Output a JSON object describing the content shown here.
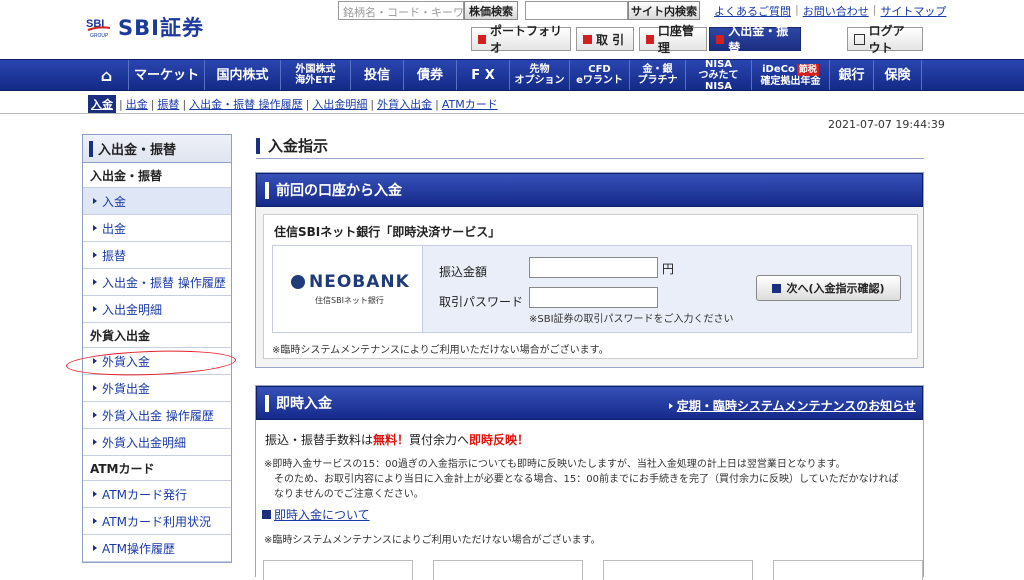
{
  "header": {
    "logo_text": "SBI証券",
    "logo_sub": "GROUP",
    "brand_search_placeholder": "銘柄名・コード・キーワード",
    "brand_search_button": "株価検索",
    "site_search_button": "サイト内検索",
    "links": [
      "よくあるご質問",
      "お問い合わせ",
      "サイトマップ"
    ],
    "top_buttons": [
      "ポートフォリオ",
      "取 引",
      "口座管理",
      "入出金・振替"
    ],
    "logout": "ログアウト"
  },
  "nav": {
    "home": "⌂",
    "items": [
      "マーケット",
      "国内株式",
      "外国株式",
      "海外ETF",
      "投信",
      "債券",
      "F X",
      "先物",
      "オプション",
      "CFD",
      "eワラント",
      "金・銀",
      "プラチナ",
      "NISA",
      "つみたてNISA",
      "iDeCo",
      "節税",
      "確定拠出年金",
      "銀行",
      "保険"
    ]
  },
  "subnav": [
    "入金",
    "出金",
    "振替",
    "入出金・振替 操作履歴",
    "入出金明細",
    "外貨入出金",
    "ATMカード"
  ],
  "datetime": "2021-07-07 19:44:39",
  "sidebar": {
    "title": "入出金・振替",
    "groups": [
      {
        "head": "入出金・振替",
        "items": [
          "入金",
          "出金",
          "振替",
          "入出金・振替 操作履歴",
          "入出金明細"
        ]
      },
      {
        "head": "外貨入出金",
        "items": [
          "外貨入金",
          "外貨出金",
          "外貨入出金 操作履歴",
          "外貨入出金明細"
        ]
      },
      {
        "head": "ATMカード",
        "items": [
          "ATMカード発行",
          "ATMカード利用状況",
          "ATM操作履歴"
        ]
      }
    ]
  },
  "main": {
    "title": "入金指示",
    "panel1": {
      "head": "前回の口座から入金",
      "bank": "住信SBIネット銀行「即時決済サービス」",
      "bank_logo": "NEOBANK",
      "bank_logo_sub": "住信SBIネット銀行",
      "amount_label": "振込金額",
      "amount_value": "",
      "yen": "円",
      "password_label": "取引パスワード",
      "password_value": "",
      "password_note": "※SBI証券の取引パスワードをご入力ください",
      "next_button": "次へ(入金指示確認)",
      "maintenance_note": "※臨時システムメンテナンスによりご利用いただけない場合がございます。"
    },
    "panel2": {
      "head": "即時入金",
      "notice_link": "定期・臨時システムメンテナンスのお知らせ",
      "fee_pre": "振込・振替手数料は",
      "fee_free": "無料！",
      "fee_mid": "買付余力へ",
      "fee_instant": "即時反映！",
      "note1": "※即時入金サービスの15：00過ぎの入金指示についても即時に反映いたしますが、当社入金処理の計上日は翌営業日となります。",
      "note2": "そのため、お取引内容により当日に入金計上が必要となる場合、15：00前までにお手続きを完了（買付余力に反映）していただかなければ",
      "note3": "なりませんのでご注意ください。",
      "about_link": "即時入金について",
      "maintenance_note": "※臨時システムメンテナンスによりご利用いただけない場合がございます。"
    }
  },
  "colors": {
    "brand_blue": "#1b2f80",
    "alert_red": "#e0140e",
    "annotation_circle": "#e0242a"
  }
}
